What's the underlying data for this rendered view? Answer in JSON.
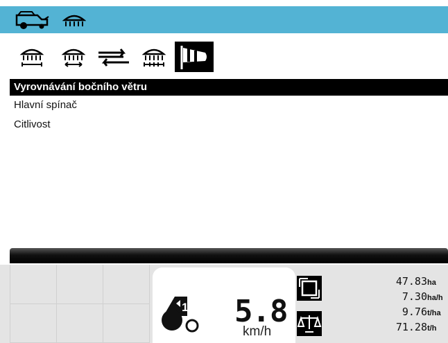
{
  "tabs": [
    {
      "icon": "spreader-width-icon",
      "selected": false
    },
    {
      "icon": "spreader-border-icon",
      "selected": false
    },
    {
      "icon": "direction-swap-icon",
      "selected": false
    },
    {
      "icon": "spreader-sections-icon",
      "selected": false
    },
    {
      "icon": "windsock-icon",
      "selected": true
    }
  ],
  "menu": {
    "title": "Vyrovnávání bočního větru",
    "items": [
      "Hlavní spínač",
      "Citlivost"
    ]
  },
  "status": {
    "gear": "1",
    "speed": "5.8",
    "speed_unit": "km/h",
    "readouts": [
      {
        "value": "47.83",
        "unit": "ha"
      },
      {
        "value": "7.30",
        "unit": "ha/h"
      },
      {
        "value": "9.76",
        "unit": "t/ha"
      },
      {
        "value": "71.28",
        "unit": "t/h"
      }
    ]
  },
  "colors": {
    "title_bar": "#53b3d4",
    "selection": "#000000"
  }
}
